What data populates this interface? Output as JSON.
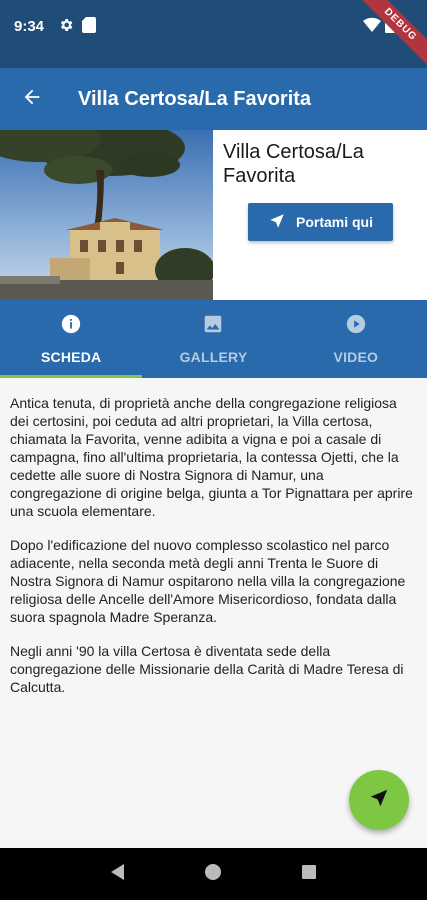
{
  "status_bar": {
    "time": "9:34",
    "debug_label": "DEBUG",
    "icons": [
      "settings-icon",
      "sd-card-icon",
      "wifi-icon",
      "battery-icon"
    ]
  },
  "app_bar": {
    "title": "Villa Certosa/La Favorita",
    "back_icon": "arrow-back-icon"
  },
  "hero": {
    "place_name": "Villa Certosa/La Favorita",
    "nav_button_label": "Portami qui",
    "nav_button_icon": "navigation-icon"
  },
  "tabs": [
    {
      "label": "SCHEDA",
      "icon": "info-icon",
      "active": true
    },
    {
      "label": "GALLERY",
      "icon": "image-icon",
      "active": false
    },
    {
      "label": "VIDEO",
      "icon": "play-icon",
      "active": false
    }
  ],
  "content": {
    "paragraphs": [
      "Antica tenuta, di proprietà anche della congregazione religiosa dei certosini, poi ceduta ad altri proprietari, la Villa certosa, chiamata la Favorita, venne adibita a vigna e poi a casale di campagna, fino all'ultima proprietaria, la contessa Ojetti, che la cedette alle suore di Nostra Signora di Namur, una congregazione di origine belga, giunta a Tor Pignattara per aprire una scuola elementare.",
      "Dopo l'edificazione del nuovo complesso scolastico nel parco adiacente, nella seconda metà degli anni Trenta le Suore di Nostra Signora di Namur ospitarono nella villa la congregazione religiosa delle Ancelle dell'Amore Misericordioso, fondata dalla suora spagnola Madre Speranza.",
      "Negli anni '90 la villa Certosa è diventata sede della congregazione delle Missionarie della Carità di Madre Teresa di Calcutta."
    ]
  },
  "fab": {
    "icon": "navigation-icon"
  },
  "colors": {
    "primary": "#286aab",
    "status_bar": "#1f4d77",
    "accent": "#7ec742",
    "inactive_tab": "#b4cbe2"
  }
}
